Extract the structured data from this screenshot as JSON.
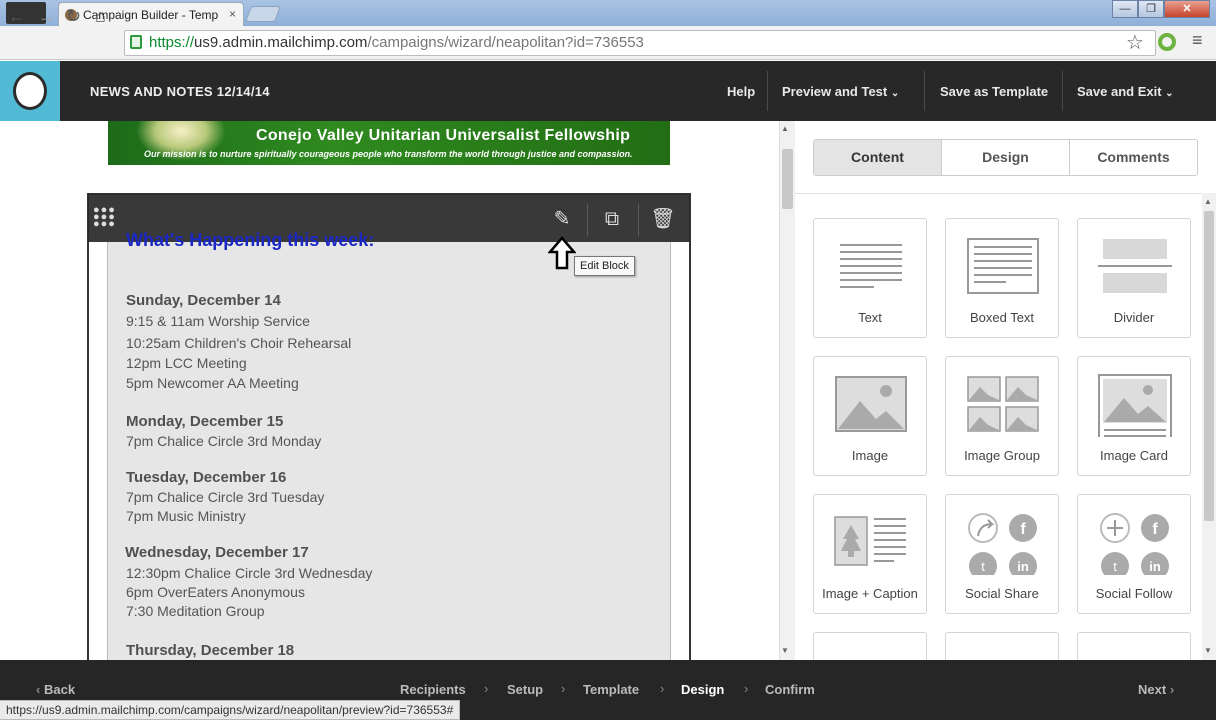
{
  "browser": {
    "tab_title": "Campaign Builder - Temp",
    "tab_close": "×",
    "url_scheme": "https://",
    "url_host": "us9.admin.mailchimp.com",
    "url_path": "/campaigns/wizard/neapolitan?id=736553",
    "win_min": "—",
    "win_max": "❐",
    "win_close": "✕"
  },
  "header": {
    "campaign_name": "NEWS AND NOTES 12/14/14",
    "help": "Help",
    "preview": "Preview and Test",
    "save_template": "Save as Template",
    "save_exit": "Save and Exit"
  },
  "banner": {
    "title": "Conejo Valley Unitarian Universalist Fellowship",
    "mission": "Our mission is to nurture spiritually courageous people who transform the world through justice and compassion."
  },
  "block": {
    "heading": "What's Happening this week:",
    "tooltip": "Edit Block",
    "days": [
      {
        "label": "Sunday, December 14",
        "events": [
          "9:15 & 11am Worship Service",
          "10:25am Children's Choir Rehearsal",
          "12pm LCC Meeting",
          "5pm Newcomer AA Meeting"
        ]
      },
      {
        "label": "Monday, December 15",
        "events": [
          "7pm Chalice Circle 3rd Monday"
        ]
      },
      {
        "label": "Tuesday, December 16",
        "events": [
          "7pm Chalice Circle 3rd Tuesday",
          "7pm Music Ministry"
        ]
      },
      {
        "label": "Wednesday, December 17",
        "events": [
          "12:30pm Chalice Circle 3rd Wednesday",
          "6pm OverEaters Anonymous",
          "7:30 Meditation Group"
        ]
      },
      {
        "label": "Thursday, December 18",
        "events": []
      }
    ]
  },
  "panel": {
    "tabs": [
      "Content",
      "Design",
      "Comments"
    ],
    "blocks": [
      "Text",
      "Boxed Text",
      "Divider",
      "Image",
      "Image Group",
      "Image Card",
      "Image + Caption",
      "Social Share",
      "Social Follow"
    ]
  },
  "footer": {
    "back": "Back",
    "steps": [
      "Recipients",
      "Setup",
      "Template",
      "Design",
      "Confirm"
    ],
    "current_step": "Design",
    "next": "Next",
    "status_url": "https://us9.admin.mailchimp.com/campaigns/wizard/neapolitan/preview?id=736553#"
  },
  "colors": {
    "header_bg": "#282828",
    "logo_bg": "#52bad5",
    "heading_blue": "#1a27c4",
    "banner_green": "#2f8a1f"
  }
}
